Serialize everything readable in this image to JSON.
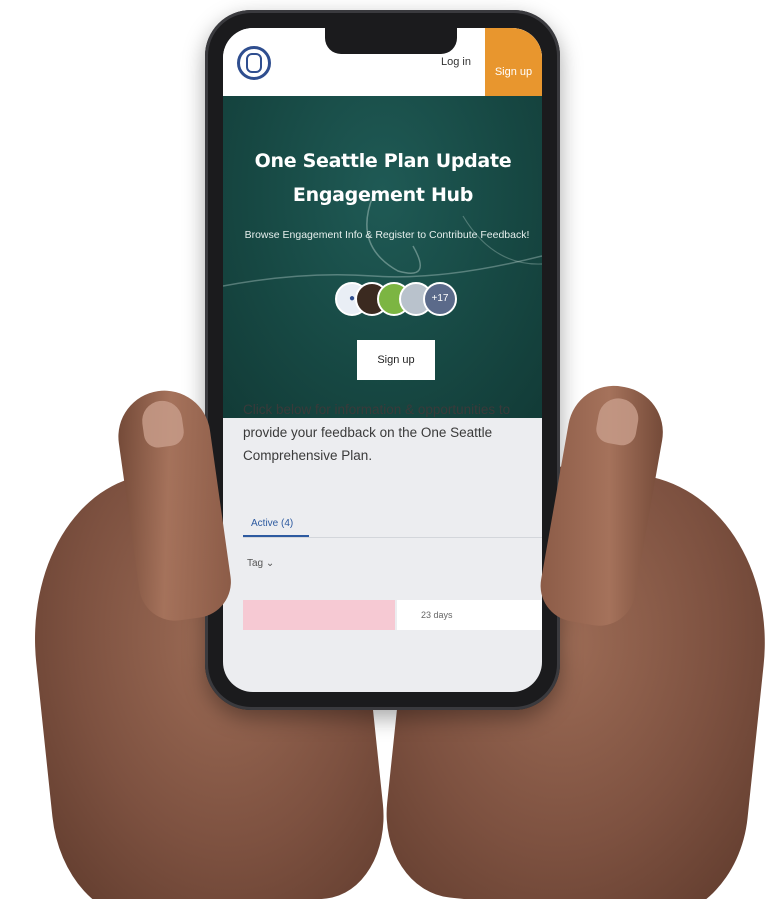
{
  "header": {
    "login_label": "Log in",
    "signup_label": "Sign up"
  },
  "hero": {
    "title": "One Seattle Plan Update Engagement Hub",
    "subtitle": "Browse Engagement Info & Register to Contribute Feedback!",
    "extra_participants_badge": "+17",
    "signup_button_label": "Sign up"
  },
  "main": {
    "intro_text": "Click below for information & opportunities to provide your feedback on the One Seattle Comprehensive Plan.",
    "tabs": [
      {
        "label": "Active (4)"
      }
    ],
    "filter_label": "Tag ⌄",
    "card_days": "23 days"
  },
  "colors": {
    "brand_blue": "#2f4e8f",
    "signup_orange": "#e8962e",
    "hero_green": "#174944",
    "tab_blue": "#2d5aa0",
    "card_pink": "#f6c9d3"
  }
}
